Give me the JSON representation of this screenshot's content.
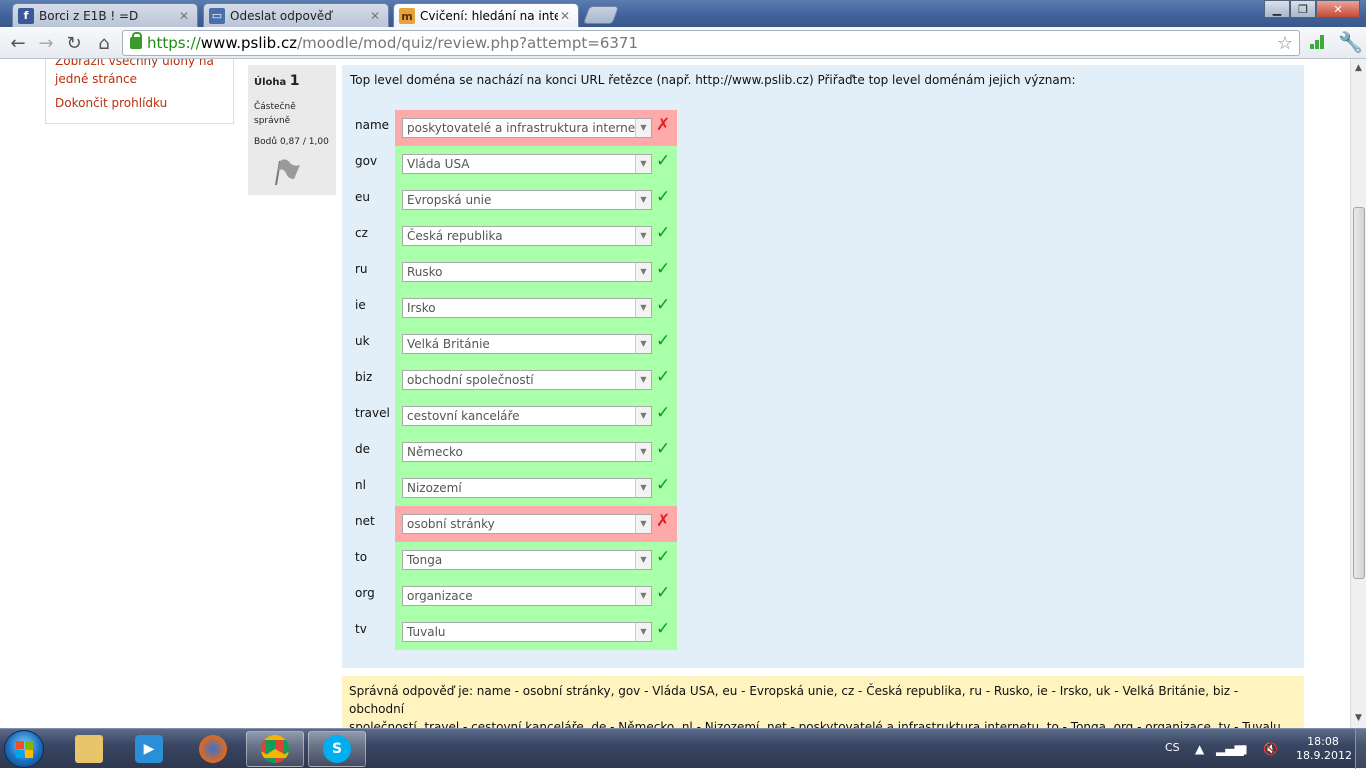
{
  "browser": {
    "tabs": [
      {
        "title": "Borci z E1B ! =D",
        "icon": "facebook-icon"
      },
      {
        "title": "Odeslat odpověď",
        "icon": "moodle-page-icon"
      },
      {
        "title": "Cvičení: hledání na interne",
        "icon": "moodle-icon"
      }
    ],
    "url": {
      "scheme": "https://",
      "host": "www.pslib.cz",
      "path": "/moodle/mod/quiz/review.php?attempt=6371"
    }
  },
  "nav": {
    "show_all_link": "Zobrazit všechny úlohy na jedné stránce",
    "show_all_line1": "Zobrazit všechny úlohy na",
    "show_all_line2": "jedné stránce",
    "finish_link": "Dokončit prohlídku"
  },
  "question": {
    "label": "Úloha",
    "number": "1",
    "state_line1": "Částečně",
    "state_line2": "správně",
    "grade": "Bodů 0,87 / 1,00",
    "text": "Top level doména se nachází na konci URL řetězce (např. http://www.pslib.cz) Přiřaďte top level doménám jejich význam:",
    "rows": [
      {
        "label": "name",
        "answer": "poskytovatelé a infrastruktura internetu",
        "correct": false
      },
      {
        "label": "gov",
        "answer": "Vláda USA",
        "correct": true
      },
      {
        "label": "eu",
        "answer": "Evropská unie",
        "correct": true
      },
      {
        "label": "cz",
        "answer": "Česká republika",
        "correct": true
      },
      {
        "label": "ru",
        "answer": "Rusko",
        "correct": true
      },
      {
        "label": "ie",
        "answer": "Irsko",
        "correct": true
      },
      {
        "label": "uk",
        "answer": "Velká Británie",
        "correct": true
      },
      {
        "label": "biz",
        "answer": "obchodní společností",
        "correct": true
      },
      {
        "label": "travel",
        "answer": "cestovní kanceláře",
        "correct": true
      },
      {
        "label": "de",
        "answer": "Německo",
        "correct": true
      },
      {
        "label": "nl",
        "answer": "Nizozemí",
        "correct": true
      },
      {
        "label": "net",
        "answer": "osobní stránky",
        "correct": false
      },
      {
        "label": "to",
        "answer": "Tonga",
        "correct": true
      },
      {
        "label": "org",
        "answer": "organizace",
        "correct": true
      },
      {
        "label": "tv",
        "answer": "Tuvalu",
        "correct": true
      }
    ],
    "right_answer_line1": "Správná odpověď je: name - osobní stránky, gov - Vláda USA, eu - Evropská unie, cz - Česká republika, ru - Rusko, ie - Irsko, uk - Velká Británie, biz - obchodní",
    "right_answer_line2": "společností, travel - cestovní kanceláře, de - Německo, nl - Nizozemí, net - poskytovatelé a infrastruktura internetu, to - Tonga, org - organizace, tv - Tuvalu."
  },
  "taskbar": {
    "apps": [
      "explorer-icon",
      "media-player-icon",
      "firefox-icon",
      "chrome-icon",
      "skype-icon"
    ],
    "lang": "CS",
    "time": "18:08",
    "date": "18.9.2012"
  },
  "colors": {
    "correct_bg": "#aaffaa",
    "incorrect_bg": "#ffaaaa",
    "question_bg": "#e3eff8",
    "right_answer_bg": "#fff3bf",
    "link": "#b9310e"
  }
}
